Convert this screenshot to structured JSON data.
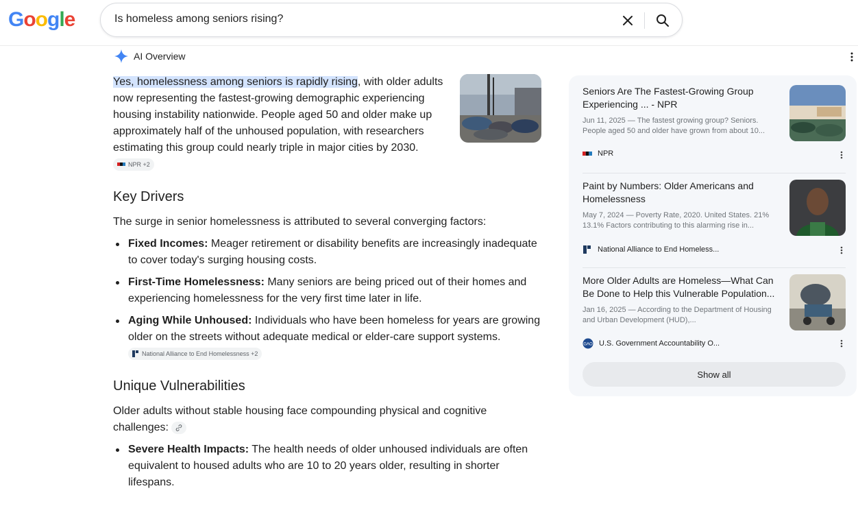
{
  "logo": {
    "letters": [
      "G",
      "o",
      "o",
      "g",
      "l",
      "e"
    ],
    "colors": [
      "#4285F4",
      "#EA4335",
      "#FBBC05",
      "#4285F4",
      "#34A853",
      "#EA4335"
    ]
  },
  "search": {
    "value": "Is homeless among seniors rising?",
    "clear_icon": "close-icon",
    "search_icon": "search-icon"
  },
  "ai_overview": {
    "title": "AI Overview",
    "intro_highlight": "Yes, homelessness among seniors is rapidly rising",
    "intro_rest": ", with older adults now representing the fastest-growing demographic experiencing housing instability nationwide. People aged 50 and older make up approximately half of the unhoused population, with researchers estimating this group could nearly triple in major cities by 2030.",
    "intro_chip": "NPR +2",
    "sections": [
      {
        "heading": "Key Drivers",
        "paragraph": "The surge in senior homelessness is attributed to several converging factors:",
        "bullets": [
          {
            "label": "Fixed Incomes:",
            "text": " Meager retirement or disability benefits are increasingly inadequate to cover today's surging housing costs."
          },
          {
            "label": "First-Time Homelessness:",
            "text": " Many seniors are being priced out of their homes and experiencing homelessness for the very first time later in life."
          },
          {
            "label": "Aging While Unhoused:",
            "text": " Individuals who have been homeless for years are growing older on the streets without adequate medical or elder-care support systems.",
            "chip": "National Alliance to End Homelessness +2"
          }
        ]
      },
      {
        "heading": "Unique Vulnerabilities",
        "paragraph": "Older adults without stable housing face compounding physical and cognitive challenges:",
        "bullets": [
          {
            "label": "Severe Health Impacts:",
            "text": " The health needs of older unhoused individuals are often equivalent to housed adults who are 10 to 20 years older, resulting in shorter lifespans."
          }
        ]
      }
    ]
  },
  "sources": [
    {
      "title": "Seniors Are The Fastest-Growing Group Experiencing ... - NPR",
      "snippet": "Jun 11, 2025 — The fastest growing group? Seniors. People aged 50 and older have grown from about 10...",
      "source": "NPR"
    },
    {
      "title": "Paint by Numbers: Older Americans and Homelessness",
      "snippet": "May 7, 2024 — Poverty Rate, 2020. United States. 21% 13.1% Factors contributing to this alarming rise in...",
      "source": "National Alliance to End Homeless..."
    },
    {
      "title": "More Older Adults are Homeless—What Can Be Done to Help this Vulnerable Population...",
      "snippet": "Jan 16, 2025 — According to the Department of Housing and Urban Development (HUD),...",
      "source": "U.S. Government Accountability O..."
    }
  ],
  "show_all_label": "Show all"
}
